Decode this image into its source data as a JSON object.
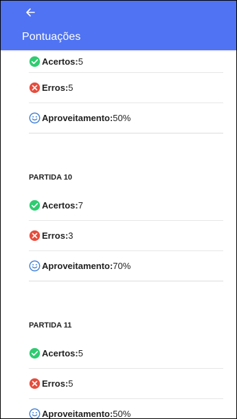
{
  "app_bar": {
    "back_icon": "arrow-left-icon",
    "title": "Pontuações",
    "color": "#4f73f2"
  },
  "stats": {
    "hits_label": "Acertos:",
    "errors_label": "Erros:",
    "performance_label": "Aproveitamento:",
    "hits_icon": "check-circle-icon",
    "errors_icon": "x-circle-icon",
    "performance_icon": "smiley-icon",
    "hits_color": "#2ecc71",
    "errors_color": "#e74c3c",
    "performance_color": "#3a7bd5"
  },
  "matches": [
    {
      "hits": "5",
      "errors": "5",
      "performance": "50%"
    },
    {
      "title": "PARTIDA 10",
      "hits": "7",
      "errors": "3",
      "performance": "70%"
    },
    {
      "title": "PARTIDA 11",
      "hits": "5",
      "errors": "5",
      "performance": "50%"
    }
  ]
}
